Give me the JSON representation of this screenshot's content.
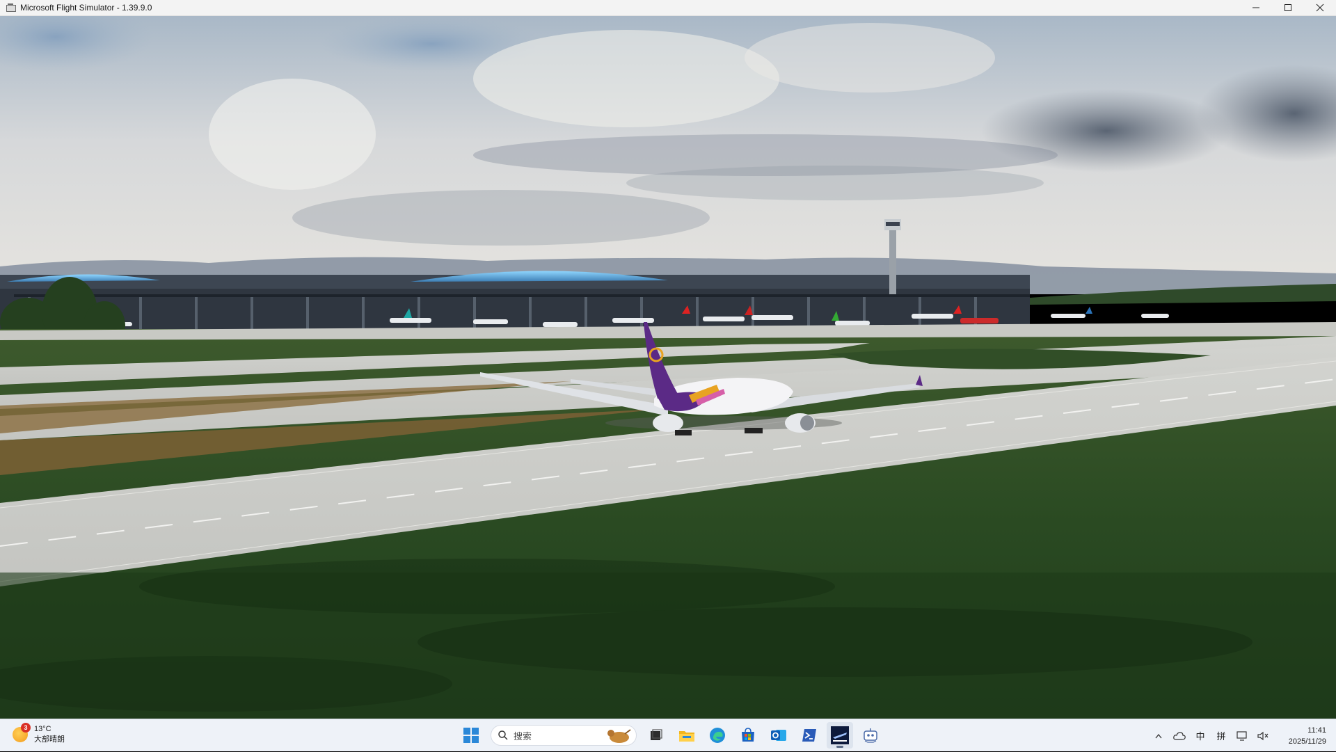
{
  "window": {
    "title": "Microsoft Flight Simulator - 1.39.9.0",
    "minimize_icon": "minimize-icon",
    "maximize_icon": "maximize-icon",
    "close_icon": "close-icon"
  },
  "scene": {
    "sky_color": "#8fa3b8",
    "grass_color": "#2c4a22",
    "pavement_color": "#c9cac6",
    "aircraft_livery_primary": "#5b2a86",
    "aircraft_livery_accent": "#e8a321"
  },
  "taskbar": {
    "weather": {
      "temperature": "13°C",
      "condition": "大部晴朗",
      "badge": "3",
      "icon": "sun-icon"
    },
    "search_placeholder": "搜索",
    "pinned_apps": [
      {
        "name": "start-button",
        "icon": "windows-logo-icon"
      },
      {
        "name": "task-view",
        "icon": "task-view-icon"
      },
      {
        "name": "file-explorer",
        "icon": "folder-icon"
      },
      {
        "name": "edge",
        "icon": "edge-icon"
      },
      {
        "name": "store",
        "icon": "store-icon"
      },
      {
        "name": "outlook",
        "icon": "outlook-icon"
      },
      {
        "name": "terminal",
        "icon": "terminal-icon"
      },
      {
        "name": "flight-simulator",
        "icon": "flight-simulator-icon"
      },
      {
        "name": "remote-app",
        "icon": "robot-icon"
      }
    ],
    "tray": {
      "overflow": "^",
      "ime_mode": "中",
      "ime_layout": "拼",
      "time": "11:41",
      "date": "2025/11/29"
    }
  }
}
